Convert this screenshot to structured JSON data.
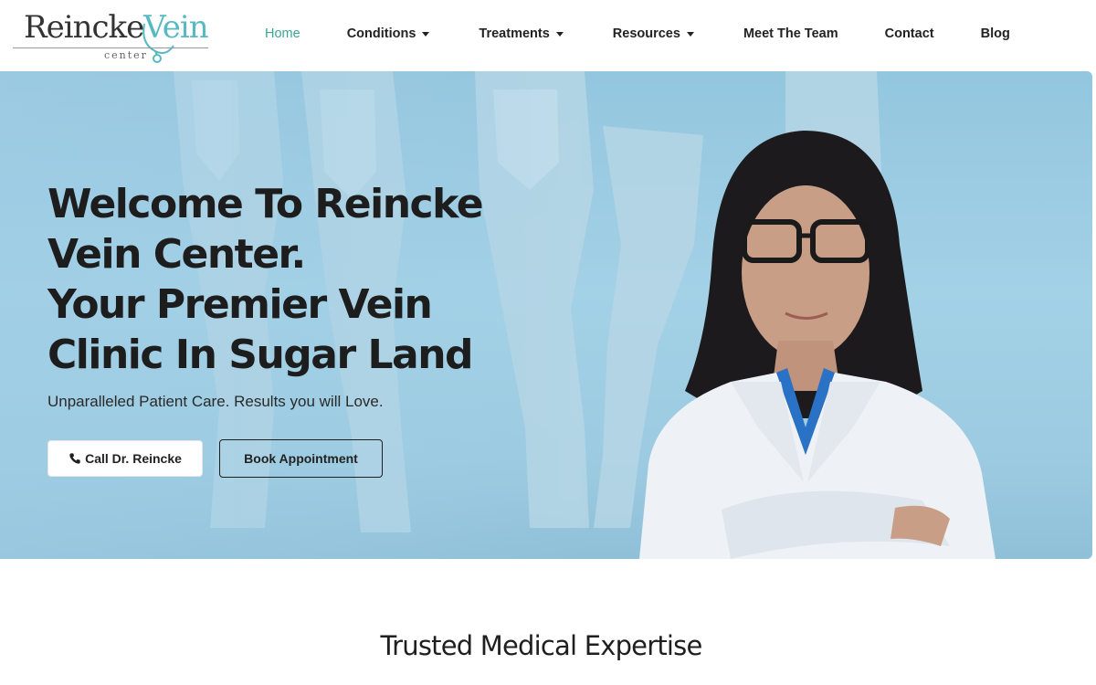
{
  "brand": {
    "logo_main": "Reincke",
    "logo_accent": "Vein",
    "logo_sub": "center",
    "accent_color": "#59b9c2"
  },
  "nav": {
    "items": [
      {
        "label": "Home",
        "active": true
      },
      {
        "label": "Conditions",
        "dropdown": true
      },
      {
        "label": "Treatments",
        "dropdown": true
      },
      {
        "label": "Resources",
        "dropdown": true
      },
      {
        "label": "Meet The Team"
      },
      {
        "label": "Contact"
      },
      {
        "label": "Blog"
      }
    ],
    "active_color": "#3aa597"
  },
  "hero": {
    "title_lines": [
      "Welcome To Reincke",
      "Vein Center.",
      "Your Premier Vein",
      "Clinic In Sugar Land"
    ],
    "subtitle": "Unparalleled Patient Care. Results you will Love.",
    "call_button": "Call Dr. Reincke",
    "book_button": "Book Appointment",
    "background_color": "#a3d1e6"
  },
  "section": {
    "title": "Trusted Medical Expertise"
  },
  "icons": {
    "phone": "phone-icon",
    "caret": "chevron-down-icon"
  }
}
